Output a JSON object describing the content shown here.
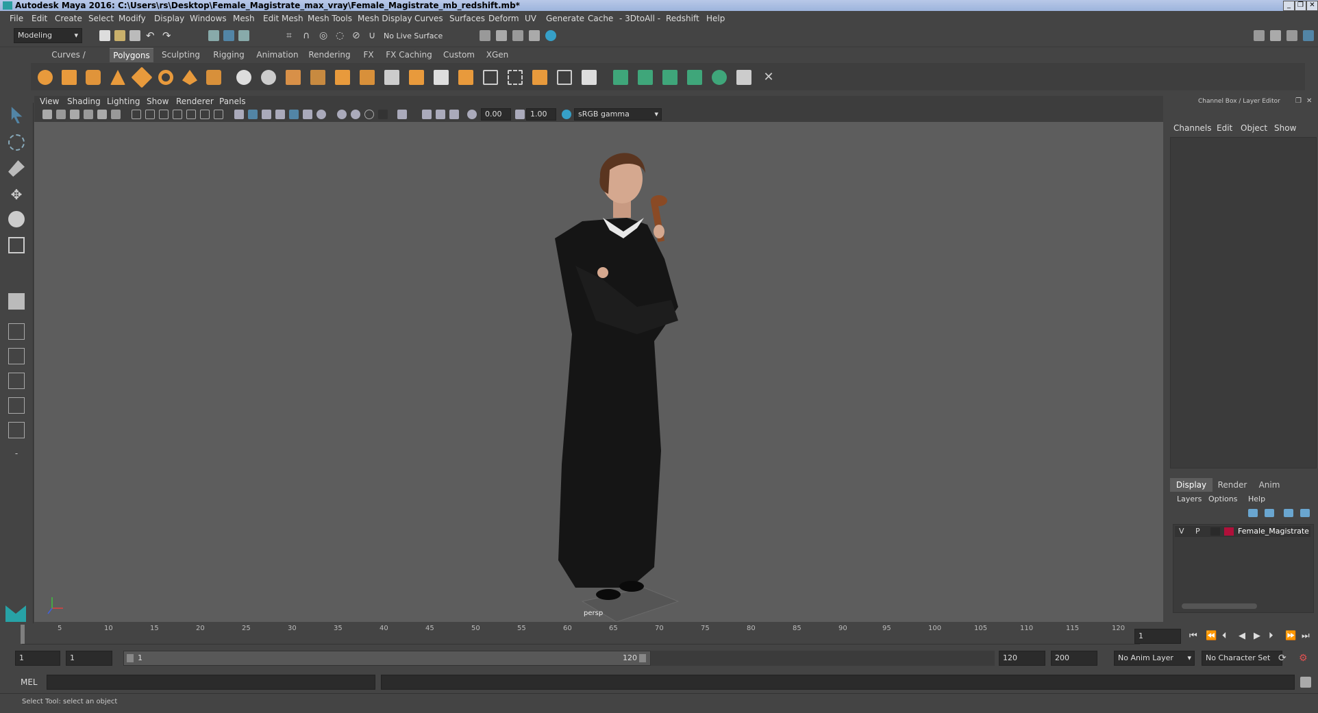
{
  "window": {
    "title": "Autodesk Maya 2016: C:\\Users\\rs\\Desktop\\Female_Magistrate_max_vray\\Female_Magistrate_mb_redshift.mb*",
    "minimize": "_",
    "maximize": "❐",
    "close": "✕"
  },
  "menus": [
    "File",
    "Edit",
    "Create",
    "Select",
    "Modify",
    "Display",
    "Windows",
    "Mesh",
    "Edit Mesh",
    "Mesh Tools",
    "Mesh Display",
    "Curves",
    "Surfaces",
    "Deform",
    "UV",
    "Generate",
    "Cache",
    "- 3DtoAll -",
    "Redshift",
    "Help"
  ],
  "toolbar": {
    "mode": "Modeling",
    "live_surface": "No Live Surface"
  },
  "shelf_tabs": [
    "Curves / Surfaces",
    "Polygons",
    "Sculpting",
    "Rigging",
    "Animation",
    "Rendering",
    "FX",
    "FX Caching",
    "Custom",
    "XGen"
  ],
  "active_shelf": "Polygons",
  "viewport": {
    "menus": [
      "View",
      "Shading",
      "Lighting",
      "Show",
      "Renderer",
      "Panels"
    ],
    "exposure": "0.00",
    "gamma": "1.00",
    "color_space": "sRGB gamma",
    "camera_label": "persp"
  },
  "channel_box": {
    "title": "Channel Box / Layer Editor",
    "menus": [
      "Channels",
      "Edit",
      "Object",
      "Show"
    ],
    "layer_tabs": [
      "Display",
      "Render",
      "Anim"
    ],
    "active_layer_tab": "Display",
    "layer_menus": [
      "Layers",
      "Options",
      "Help"
    ],
    "layer": {
      "v": "V",
      "p": "P",
      "name": "Female_Magistrate",
      "color": "#b0103a"
    }
  },
  "timeline": {
    "ticks": [
      "5",
      "10",
      "15",
      "20",
      "25",
      "30",
      "35",
      "40",
      "45",
      "50",
      "55",
      "60",
      "65",
      "70",
      "75",
      "80",
      "85",
      "90",
      "95",
      "100",
      "105",
      "110",
      "115",
      "120"
    ],
    "first_tick": "1",
    "current_frame": "1"
  },
  "range": {
    "start": "1",
    "playback_start": "1",
    "slider_start": "1",
    "slider_end": "120",
    "playback_end": "120",
    "end": "200",
    "anim_layer": "No Anim Layer",
    "character_set": "No Character Set"
  },
  "command": {
    "label": "MEL"
  },
  "status": {
    "help_text": "Select Tool: select an object"
  },
  "colors": {
    "accent_blue": "#5285a6",
    "shelf_orange": "#e89a3c",
    "shelf_green": "#3fa67a"
  }
}
